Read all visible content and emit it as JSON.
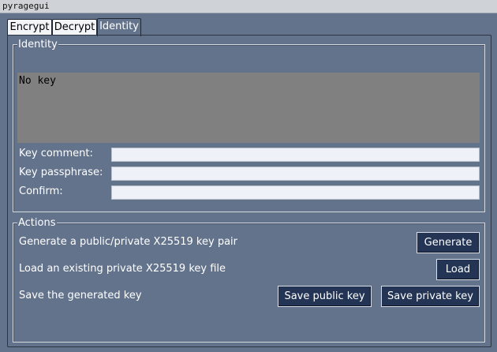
{
  "window": {
    "title": "pyragegui"
  },
  "tabs": [
    {
      "label": "Encrypt"
    },
    {
      "label": "Decrypt"
    },
    {
      "label": "Identity"
    }
  ],
  "identity": {
    "frame_label": "Identity",
    "key_display": "No key",
    "fields": {
      "key_comment": {
        "label": "Key comment:",
        "value": ""
      },
      "key_passphrase": {
        "label": "Key passphrase:",
        "value": ""
      },
      "confirm": {
        "label": "Confirm:",
        "value": ""
      }
    }
  },
  "actions": {
    "frame_label": "Actions",
    "generate": {
      "description": "Generate a public/private X25519 key pair",
      "button": "Generate"
    },
    "load": {
      "description": "Load an existing private X25519 key file",
      "button": "Load"
    },
    "save": {
      "description": "Save the generated key",
      "public_button": "Save public key",
      "private_button": "Save private key"
    }
  },
  "colors": {
    "background": "#64738c",
    "button": "#233455",
    "key_display": "#808080",
    "entry": "#eef1f7"
  }
}
